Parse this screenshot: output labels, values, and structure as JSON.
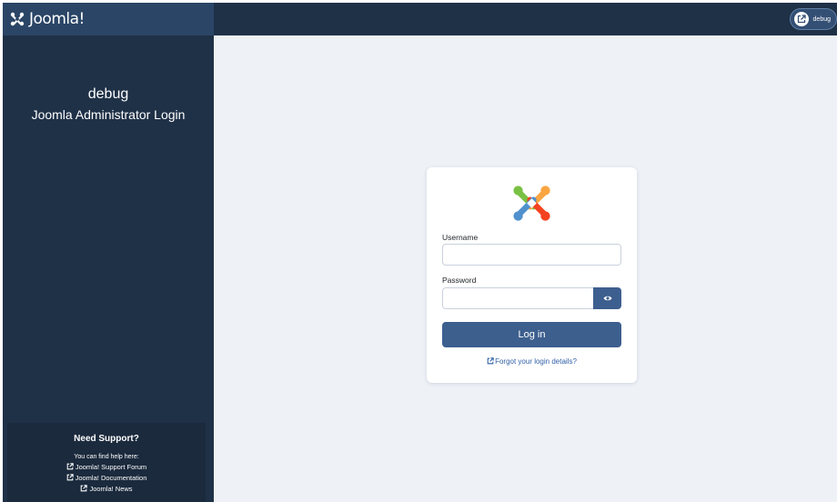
{
  "header": {
    "brand_text": "Joomla!",
    "site_button_label": "debug",
    "site_button_icon": "external-link-icon"
  },
  "sidebar": {
    "site_name": "debug",
    "login_title": "Joomla Administrator Login",
    "support": {
      "heading": "Need Support?",
      "intro": "You can find help here:",
      "links": [
        {
          "label": "Joomla! Support Forum",
          "icon": "external-link-icon"
        },
        {
          "label": "Joomla! Documentation",
          "icon": "external-link-icon"
        },
        {
          "label": "Joomla! News",
          "icon": "external-link-icon"
        }
      ]
    }
  },
  "login": {
    "logo": "joomla-logo",
    "username_label": "Username",
    "username_value": "",
    "password_label": "Password",
    "password_value": "",
    "show_password_icon": "eye-icon",
    "submit_label": "Log in",
    "forgot_link": "Forgot your login details?"
  },
  "colors": {
    "header_bg": "#1f3147",
    "brand_bg": "#2a4566",
    "sidebar_bg": "#1f3147",
    "page_bg": "#eef2f7",
    "primary_button": "#3c5f8e",
    "link": "#2f5fa6",
    "logo_green": "#7ac143",
    "logo_orange": "#f9a541",
    "logo_red": "#f44321",
    "logo_blue": "#5091cd"
  }
}
